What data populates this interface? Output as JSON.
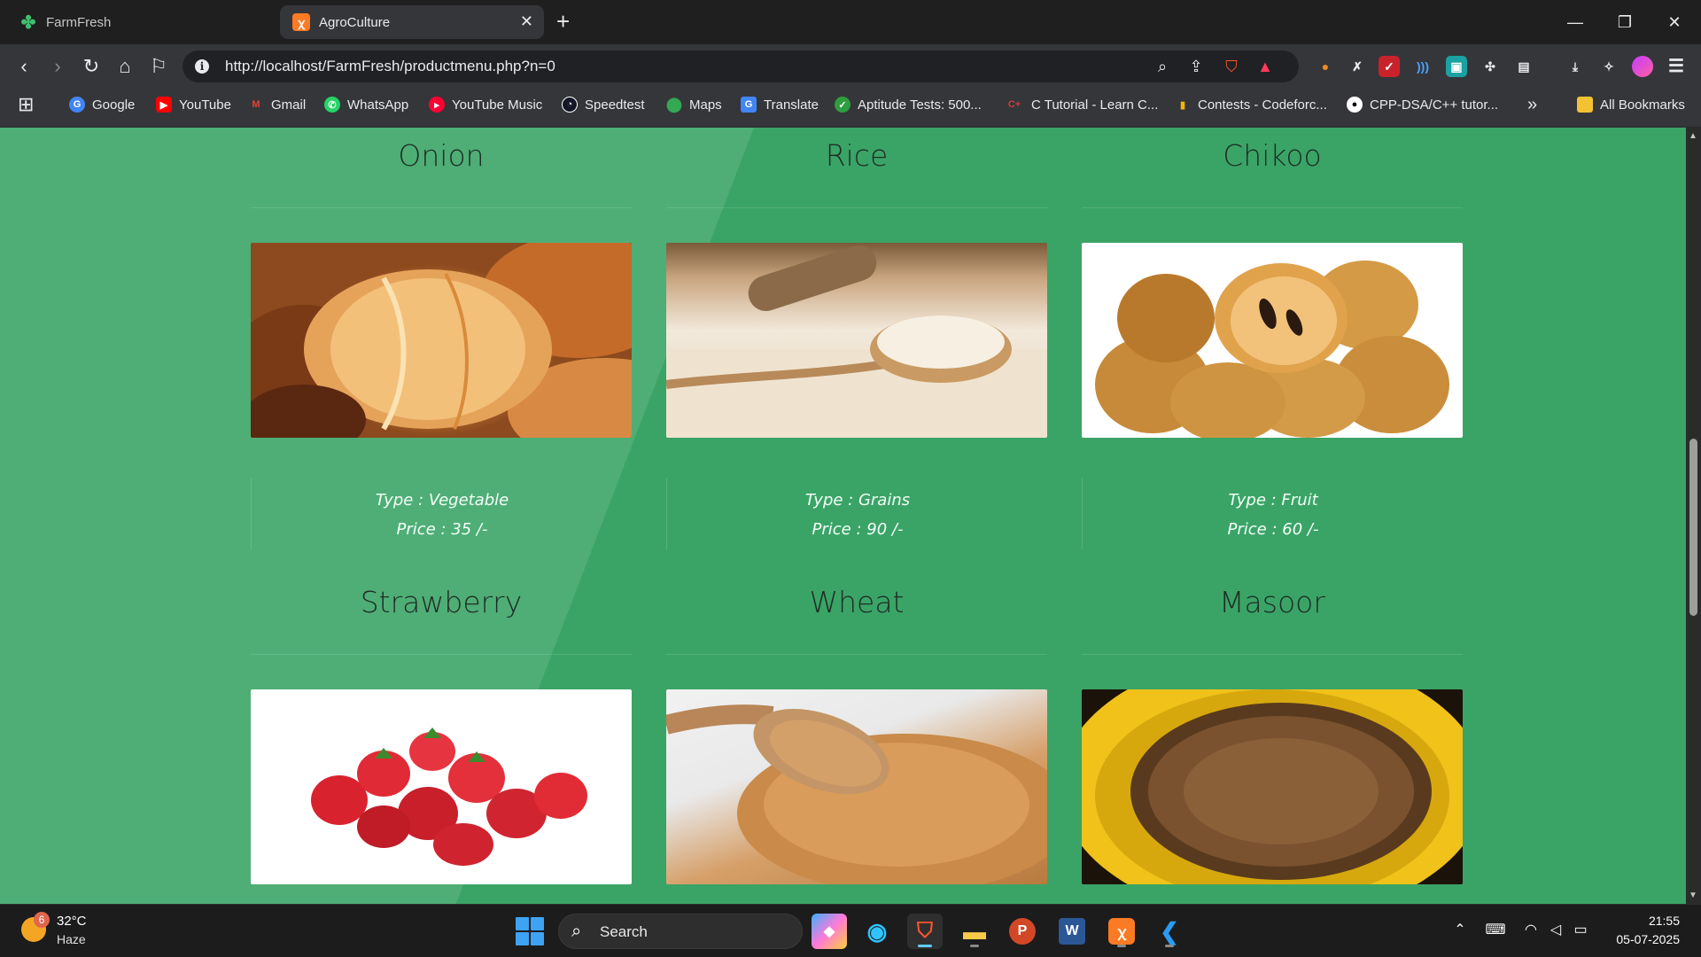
{
  "browser": {
    "tabs": [
      {
        "title": "FarmFresh",
        "icon": "clover-icon",
        "active": false
      },
      {
        "title": "AgroCulture",
        "icon": "xampp-icon",
        "active": true
      }
    ],
    "new_tab_symbol": "+",
    "url": "http://localhost/FarmFresh/productmenu.php?n=0",
    "bookmarks": [
      {
        "label": "Google",
        "icon": "google-icon",
        "color": "#4285f4"
      },
      {
        "label": "YouTube",
        "icon": "youtube-icon",
        "color": "#ff0000"
      },
      {
        "label": "Gmail",
        "icon": "gmail-icon",
        "color": "#ea4335"
      },
      {
        "label": "WhatsApp",
        "icon": "whatsapp-icon",
        "color": "#25d366"
      },
      {
        "label": "YouTube Music",
        "icon": "youtube-music-icon",
        "color": "#ff0033"
      },
      {
        "label": "Speedtest",
        "icon": "speedtest-icon",
        "color": "#141526"
      },
      {
        "label": "Maps",
        "icon": "maps-icon",
        "color": "#34a853"
      },
      {
        "label": "Translate",
        "icon": "translate-icon",
        "color": "#4285f4"
      },
      {
        "label": "Aptitude Tests: 500...",
        "icon": "check-circle-icon",
        "color": "#2e9e3e"
      },
      {
        "label": "C Tutorial - Learn C...",
        "icon": "c-plus-icon",
        "color": "#d43b3b"
      },
      {
        "label": "Contests - Codeforc...",
        "icon": "codeforces-icon",
        "color": "#f2b700"
      },
      {
        "label": "CPP-DSA/C++ tutor...",
        "icon": "github-icon",
        "color": "#ffffff"
      }
    ],
    "bookmarks_overflow": "»",
    "all_bookmarks": "All Bookmarks"
  },
  "products": [
    {
      "name": "Onion",
      "image": "onion-image",
      "type": "Type : Vegetable",
      "price": "Price : 35 /-"
    },
    {
      "name": "Rice",
      "image": "rice-image",
      "type": "Type : Grains",
      "price": "Price : 90 /-"
    },
    {
      "name": "Chikoo",
      "image": "chikoo-image",
      "type": "Type : Fruit",
      "price": "Price : 60 /-"
    },
    {
      "name": "Strawberry",
      "image": "strawberry-image"
    },
    {
      "name": "Wheat",
      "image": "wheat-image"
    },
    {
      "name": "Masoor",
      "image": "masoor-image"
    }
  ],
  "scrollbar": {
    "position_fraction": 0.52
  },
  "taskbar": {
    "weather_temp": "32°C",
    "weather_desc": "Haze",
    "weather_badge": "6",
    "search_label": "Search",
    "apps": [
      "copilot-icon",
      "edge-icon",
      "brave-icon",
      "file-explorer-icon",
      "powerpoint-icon",
      "word-icon",
      "xampp-icon",
      "vscode-icon"
    ],
    "time": "21:55",
    "date": "05-07-2025"
  }
}
